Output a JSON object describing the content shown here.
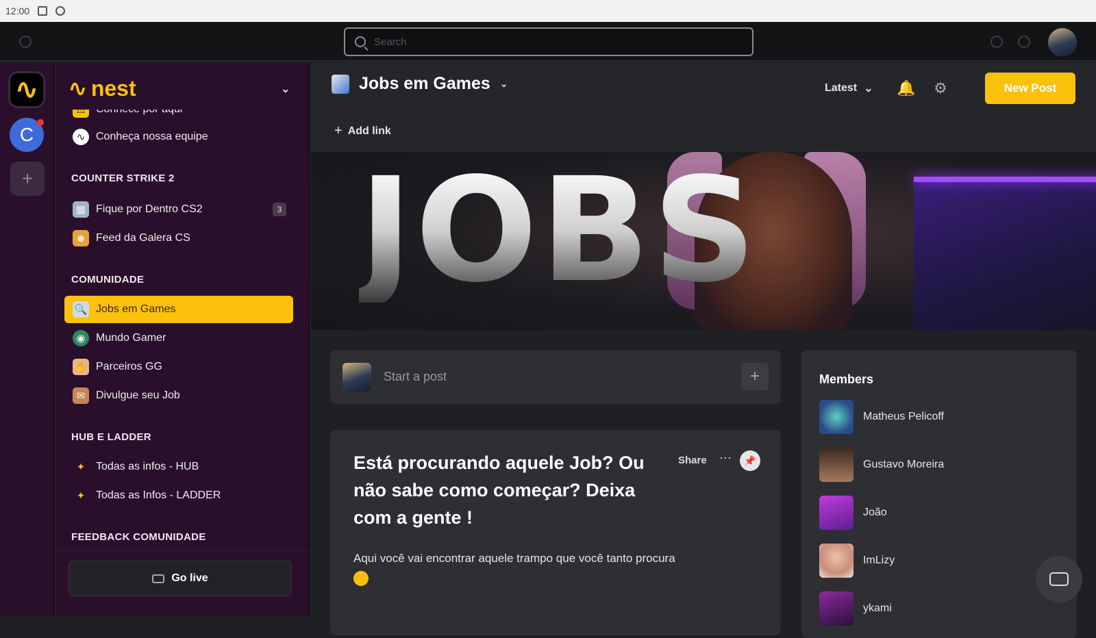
{
  "status_bar": {
    "time": "12:00"
  },
  "top": {
    "search_placeholder": "Search"
  },
  "brand": {
    "name": "nest",
    "logo_glyph": "∿"
  },
  "rail": {
    "server_c_letter": "C",
    "add_glyph": "+"
  },
  "sidebar": {
    "items_top": [
      {
        "label": "Conhece por aqui",
        "icon": "warning-icon"
      },
      {
        "label": "Conheça nossa equipe",
        "icon": "nest-logo-icon"
      }
    ],
    "sections": [
      {
        "title": "COUNTER STRIKE 2",
        "items": [
          {
            "label": "Fique por Dentro CS2",
            "badge": "3",
            "icon": "calendar-icon"
          },
          {
            "label": "Feed da Galera CS",
            "icon": "people-icon"
          }
        ]
      },
      {
        "title": "COMUNIDADE",
        "items": [
          {
            "label": "Jobs em Games",
            "icon": "job-search-icon",
            "active": true
          },
          {
            "label": "Mundo Gamer",
            "icon": "globe-icon"
          },
          {
            "label": "Parceiros GG",
            "icon": "handshake-icon"
          },
          {
            "label": "Divulgue seu Job",
            "icon": "megaphone-icon"
          }
        ]
      },
      {
        "title": "HUB E LADDER",
        "items": [
          {
            "label": "Todas as infos - HUB",
            "icon": "satellite-icon"
          },
          {
            "label": "Todas as Infos - LADDER",
            "icon": "satellite-icon"
          }
        ]
      },
      {
        "title": "FEEDBACK COMUNIDADE",
        "items": []
      }
    ],
    "go_live": "Go live"
  },
  "header": {
    "title": "Jobs em Games",
    "sort": "Latest",
    "new_post": "New Post",
    "add_link": "Add link"
  },
  "banner": {
    "text": "JOBS"
  },
  "composer": {
    "placeholder": "Start a post",
    "plus": "+"
  },
  "post": {
    "title": "Está procurando aquele Job? Ou não sabe como começar? Deixa com a gente !",
    "share": "Share",
    "more": "···",
    "body": "Aqui você vai encontrar aquele trampo que você tanto procura"
  },
  "members": {
    "title": "Members",
    "list": [
      {
        "name": "Matheus Pelicoff"
      },
      {
        "name": "Gustavo Moreira"
      },
      {
        "name": "João"
      },
      {
        "name": "ImLizy"
      },
      {
        "name": "ykami"
      }
    ]
  },
  "colors": {
    "accent": "#fcc10c",
    "sidebar_bg": "#2a0f2c",
    "main_bg": "#1f2024",
    "card_bg": "#2e2f33"
  }
}
